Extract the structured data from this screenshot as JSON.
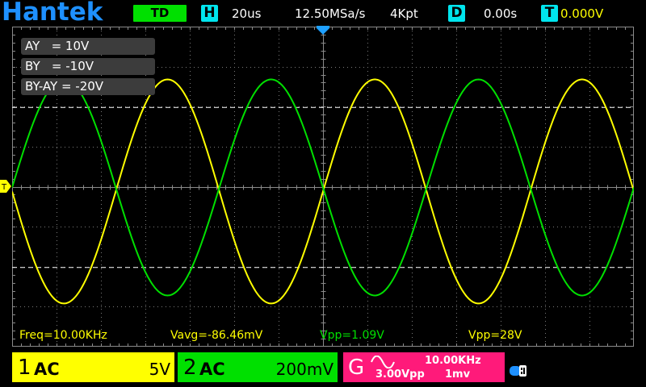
{
  "app": {
    "brand": "Hantek"
  },
  "header": {
    "mode": "TD",
    "timebase_tag": "H",
    "timebase": "20us",
    "sample_rate": "12.50MSa/s",
    "memory_depth": "4Kpt",
    "delay_tag": "D",
    "delay": "0.00s",
    "trigger_tag": "T",
    "trigger_level": "0.000V"
  },
  "cursors": {
    "ay": "AY   = 10V",
    "by": "BY   = -10V",
    "diff": "BY-AY = -20V"
  },
  "measurements": {
    "freq": "Freq=10.00KHz",
    "avg": "Vavg=-86.46mV",
    "vpp_ch2": "Vpp=1.09V",
    "vpp_ch1": "Vpp=28V"
  },
  "channels": [
    {
      "num": "1",
      "coupling": "AC",
      "scale": "5V",
      "color": "#ffff00"
    },
    {
      "num": "2",
      "coupling": "AC",
      "scale": "200mV",
      "color": "#00e000"
    }
  ],
  "generator": {
    "letter": "G",
    "waveform_icon": "sine-wave-icon",
    "frequency": "10.00KHz",
    "amplitude": "3.00Vpp",
    "offset": "1mv",
    "color": "#ff1a7a"
  },
  "status_icons": [
    "usb-icon"
  ],
  "grid": {
    "divisions_x": 14,
    "divisions_y": 8
  },
  "chart_data": {
    "type": "line",
    "x_range_div": [
      0,
      14
    ],
    "y_range_div": [
      -4,
      4
    ],
    "grid": true,
    "series": [
      {
        "name": "CH1",
        "color": "#ffff00",
        "waveform": "sine",
        "cycles_on_screen": 3,
        "peak_div": 2.8,
        "offset_div": -0.1,
        "phase_deg": 180
      },
      {
        "name": "CH2",
        "color": "#00e000",
        "waveform": "sine",
        "cycles_on_screen": 3,
        "peak_div": 2.7,
        "offset_div": 0.0,
        "phase_deg": 0
      }
    ]
  }
}
